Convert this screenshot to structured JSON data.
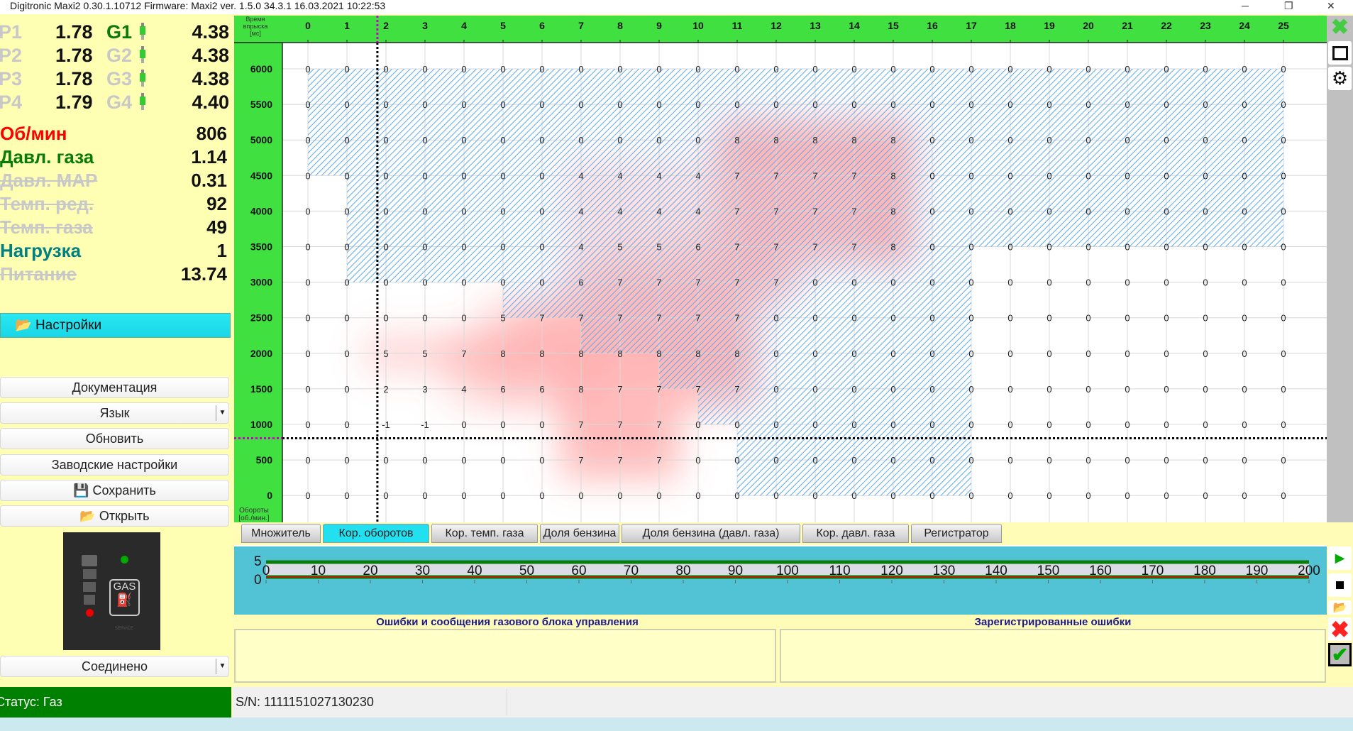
{
  "window": {
    "title": "Digitronic Maxi2 0.30.1.10712 Firmware: Maxi2  ver. 1.5.0  34.3.1   16.03.2021 10:22:53"
  },
  "injectors": [
    {
      "p_label": "P1",
      "p_value": "1.78",
      "g_label": "G1",
      "g_active": true,
      "g_value": "4.38"
    },
    {
      "p_label": "P2",
      "p_value": "1.78",
      "g_label": "G2",
      "g_active": false,
      "g_value": "4.38"
    },
    {
      "p_label": "P3",
      "p_value": "1.78",
      "g_label": "G3",
      "g_active": false,
      "g_value": "4.38"
    },
    {
      "p_label": "P4",
      "p_value": "1.79",
      "g_label": "G4",
      "g_active": false,
      "g_value": "4.40"
    }
  ],
  "sensors": [
    {
      "label": "Об/мин",
      "value": "806",
      "color": "#ff0000",
      "active": true
    },
    {
      "label": "Давл. газа",
      "value": "1.14",
      "color": "#0a7a0a",
      "active": true
    },
    {
      "label": "Давл. MAP",
      "value": "0.31",
      "color": "#c8c8c8",
      "active": false
    },
    {
      "label": "Темп. ред.",
      "value": "92",
      "color": "#c8c8c8",
      "active": false
    },
    {
      "label": "Темп. газа",
      "value": "49",
      "color": "#c8c8c8",
      "active": false
    },
    {
      "label": "Нагрузка",
      "value": "1",
      "color": "#008080",
      "active": true
    },
    {
      "label": "Питание",
      "value": "13.74",
      "color": "#c8c8c8",
      "active": false
    }
  ],
  "menu": {
    "settings": "Настройки",
    "documentation": "Документация",
    "language": "Язык",
    "refresh": "Обновить",
    "factory": "Заводские настройки",
    "save": "Сохранить",
    "open": "Открыть",
    "connection": "Соединено"
  },
  "gas_switch": {
    "label": "GAS",
    "service": "SERVICE"
  },
  "status": {
    "text": "Статус: Газ",
    "serial": "S/N: 1111151027130230"
  },
  "tabs": [
    "Множитель",
    "Кор. оборотов",
    "Кор. темп. газа",
    "Доля бензина",
    "Доля бензина (давл. газа)",
    "Кор. давл. газа",
    "Регистратор"
  ],
  "active_tab": 1,
  "recorder": {
    "y_labels": [
      "5",
      "0"
    ],
    "x_ticks": [
      "0",
      "10",
      "20",
      "30",
      "40",
      "50",
      "60",
      "70",
      "80",
      "90",
      "100",
      "110",
      "120",
      "130",
      "140",
      "150",
      "160",
      "170",
      "180",
      "190",
      "200"
    ]
  },
  "errors": {
    "ecu_title": "Ошибки и сообщения газового блока управления",
    "registered_title": "Зарегистрированные ошибки"
  },
  "chart_data": {
    "type": "heatmap",
    "title": "Кор. оборотов",
    "xlabel": "Время впрыска [мс]",
    "ylabel": "Обороты [об./мин.]",
    "x": [
      0,
      1,
      2,
      3,
      4,
      5,
      6,
      7,
      8,
      9,
      10,
      11,
      12,
      13,
      14,
      15,
      16,
      17,
      18,
      19,
      20,
      21,
      22,
      23,
      24,
      25
    ],
    "y": [
      6000,
      5500,
      5000,
      4500,
      4000,
      3500,
      3000,
      2500,
      2000,
      1500,
      1000,
      500,
      0
    ],
    "values": [
      [
        0,
        0,
        0,
        0,
        0,
        0,
        0,
        0,
        0,
        0,
        0,
        0,
        0,
        0,
        0,
        0,
        0,
        0,
        0,
        0,
        0,
        0,
        0,
        0,
        0,
        0
      ],
      [
        0,
        0,
        0,
        0,
        0,
        0,
        0,
        0,
        0,
        0,
        0,
        0,
        0,
        0,
        0,
        0,
        0,
        0,
        0,
        0,
        0,
        0,
        0,
        0,
        0,
        0
      ],
      [
        0,
        0,
        0,
        0,
        0,
        0,
        0,
        0,
        0,
        0,
        0,
        8,
        8,
        8,
        8,
        8,
        0,
        0,
        0,
        0,
        0,
        0,
        0,
        0,
        0,
        0
      ],
      [
        0,
        0,
        0,
        0,
        0,
        0,
        0,
        4,
        4,
        4,
        4,
        7,
        7,
        7,
        7,
        8,
        0,
        0,
        0,
        0,
        0,
        0,
        0,
        0,
        0,
        0
      ],
      [
        0,
        0,
        0,
        0,
        0,
        0,
        0,
        4,
        4,
        4,
        4,
        7,
        7,
        7,
        7,
        8,
        0,
        0,
        0,
        0,
        0,
        0,
        0,
        0,
        0,
        0
      ],
      [
        0,
        0,
        0,
        0,
        0,
        0,
        0,
        4,
        5,
        5,
        6,
        7,
        7,
        7,
        7,
        8,
        0,
        0,
        0,
        0,
        0,
        0,
        0,
        0,
        0,
        0
      ],
      [
        0,
        0,
        0,
        0,
        0,
        0,
        0,
        6,
        7,
        7,
        7,
        7,
        7,
        0,
        0,
        0,
        0,
        0,
        0,
        0,
        0,
        0,
        0,
        0,
        0,
        0
      ],
      [
        0,
        0,
        0,
        0,
        0,
        5,
        7,
        7,
        7,
        7,
        7,
        7,
        0,
        0,
        0,
        0,
        0,
        0,
        0,
        0,
        0,
        0,
        0,
        0,
        0,
        0
      ],
      [
        0,
        0,
        5,
        5,
        7,
        8,
        8,
        8,
        8,
        8,
        8,
        8,
        0,
        0,
        0,
        0,
        0,
        0,
        0,
        0,
        0,
        0,
        0,
        0,
        0,
        0
      ],
      [
        0,
        0,
        2,
        3,
        4,
        6,
        6,
        8,
        7,
        7,
        7,
        7,
        0,
        0,
        0,
        0,
        0,
        0,
        0,
        0,
        0,
        0,
        0,
        0,
        0,
        0
      ],
      [
        0,
        0,
        -1,
        -1,
        0,
        0,
        0,
        7,
        7,
        7,
        0,
        0,
        0,
        0,
        0,
        0,
        0,
        0,
        0,
        0,
        0,
        0,
        0,
        0,
        0,
        0
      ],
      [
        0,
        0,
        0,
        0,
        0,
        0,
        0,
        7,
        7,
        7,
        0,
        0,
        0,
        0,
        0,
        0,
        0,
        0,
        0,
        0,
        0,
        0,
        0,
        0,
        0,
        0
      ],
      [
        0,
        0,
        0,
        0,
        0,
        0,
        0,
        0,
        0,
        0,
        0,
        0,
        0,
        0,
        0,
        0,
        0,
        0,
        0,
        0,
        0,
        0,
        0,
        0,
        0,
        0
      ]
    ],
    "hatch_region": [
      [
        0,
        6000
      ],
      [
        25,
        6000
      ],
      [
        25,
        3500
      ],
      [
        17,
        3500
      ],
      [
        17,
        0
      ],
      [
        11,
        0
      ],
      [
        11,
        1000
      ],
      [
        10,
        1000
      ],
      [
        10,
        1500
      ],
      [
        9,
        1500
      ],
      [
        9,
        2000
      ],
      [
        7,
        2000
      ],
      [
        7,
        2500
      ],
      [
        5,
        2500
      ],
      [
        5,
        3000
      ],
      [
        1,
        3000
      ],
      [
        1,
        4500
      ],
      [
        0,
        4500
      ]
    ],
    "cursor": {
      "x": 1.78,
      "y": 806
    },
    "xlim": [
      0,
      25
    ],
    "ylim": [
      0,
      6000
    ],
    "colors": {
      "header": "#40e040",
      "hatch": "#5aaaf0",
      "heat": "#ff6060"
    }
  }
}
